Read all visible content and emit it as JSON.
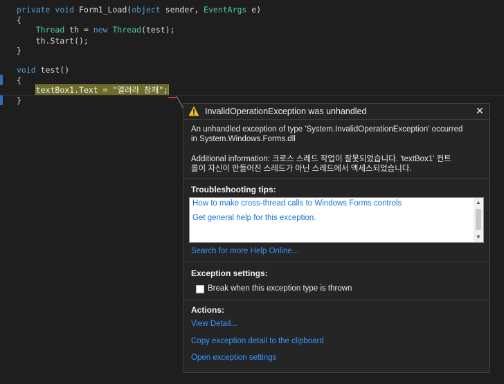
{
  "editor": {
    "lines": [
      {
        "parts": [
          {
            "t": "private ",
            "c": "kw"
          },
          {
            "t": "void ",
            "c": "kw"
          },
          {
            "t": "Form1_Load(",
            "c": ""
          },
          {
            "t": "object ",
            "c": "kw"
          },
          {
            "t": "sender, ",
            "c": ""
          },
          {
            "t": "EventArgs ",
            "c": "ty"
          },
          {
            "t": "e)",
            "c": ""
          }
        ]
      },
      {
        "parts": [
          {
            "t": "{",
            "c": ""
          }
        ]
      },
      {
        "parts": [
          {
            "t": "    ",
            "c": ""
          },
          {
            "t": "Thread ",
            "c": "ty"
          },
          {
            "t": "th = ",
            "c": ""
          },
          {
            "t": "new ",
            "c": "kw"
          },
          {
            "t": "Thread",
            "c": "ty"
          },
          {
            "t": "(test);",
            "c": ""
          }
        ]
      },
      {
        "parts": [
          {
            "t": "    th.Start();",
            "c": ""
          }
        ]
      },
      {
        "parts": [
          {
            "t": "}",
            "c": ""
          }
        ]
      },
      {
        "parts": []
      },
      {
        "parts": [
          {
            "t": "void ",
            "c": "kw"
          },
          {
            "t": "test()",
            "c": ""
          }
        ]
      },
      {
        "parts": [
          {
            "t": "{",
            "c": ""
          }
        ]
      },
      {
        "parts": [
          {
            "t": "    ",
            "c": ""
          },
          {
            "t": "textBox1.Text = \"열려라 참깨\";",
            "c": "hl"
          }
        ]
      },
      {
        "parts": [
          {
            "t": "}",
            "c": ""
          }
        ]
      }
    ]
  },
  "popup": {
    "title": "InvalidOperationException was unhandled",
    "close_glyph": "✕",
    "message_line1": "An unhandled exception of type 'System.InvalidOperationException' occurred",
    "message_line2": "in System.Windows.Forms.dll",
    "additional_line1": "Additional information: 크로스 스레드 작업이 잘못되었습니다. 'textBox1' 컨트",
    "additional_line2": "롤이 자신이 만들어진 스레드가 아닌 스레드에서 액세스되었습니다.",
    "tips_title": "Troubleshooting tips:",
    "tips": [
      "How to make cross-thread calls to Windows Forms controls",
      "Get general help for this exception."
    ],
    "search_link": "Search for more Help Online...",
    "settings_title": "Exception settings:",
    "break_label": "Break when this exception type is thrown",
    "break_checked": false,
    "actions_title": "Actions:",
    "actions": [
      "View Detail...",
      "Copy exception detail to the clipboard",
      "Open exception settings"
    ]
  },
  "colors": {
    "keyword": "#569cd6",
    "type": "#4ec9b0",
    "link": "#3794ff",
    "warning": "#f5c518"
  }
}
